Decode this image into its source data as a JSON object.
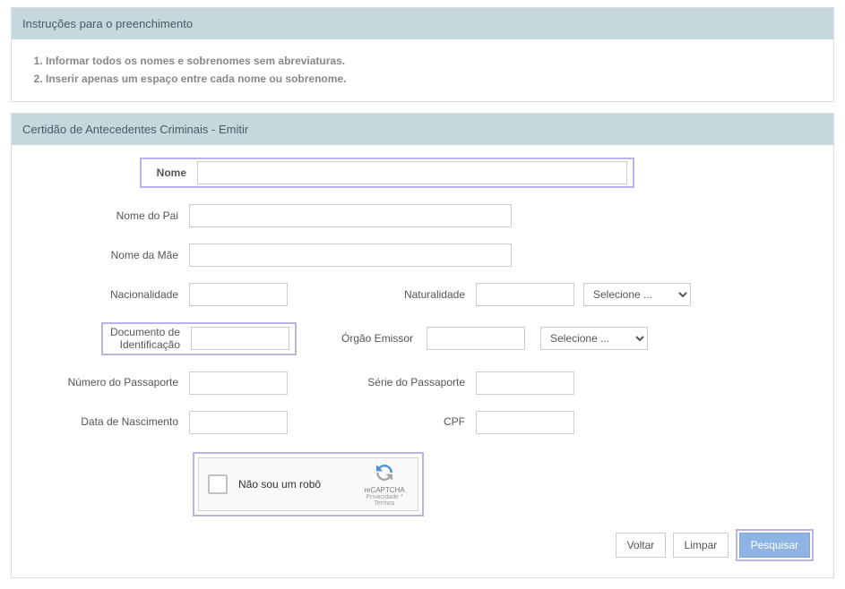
{
  "instructions": {
    "header": "Instruções para o preenchimento",
    "items": [
      "Informar todos os nomes e sobrenomes sem abreviaturas.",
      "Inserir apenas um espaço entre cada nome ou sobrenome."
    ]
  },
  "form": {
    "header": "Certidão de Antecedentes Criminais - Emitir",
    "labels": {
      "nome": "Nome",
      "nome_pai": "Nome do Pai",
      "nome_mae": "Nome da Mãe",
      "nacionalidade": "Nacionalidade",
      "naturalidade": "Naturalidade",
      "documento": "Documento de Identificação",
      "orgao": "Órgão Emissor",
      "passaporte_num": "Número do Passaporte",
      "passaporte_serie": "Série do Passaporte",
      "data_nasc": "Data de Nascimento",
      "cpf": "CPF"
    },
    "values": {
      "nome": "",
      "nome_pai": "",
      "nome_mae": "",
      "nacionalidade": "",
      "naturalidade": "",
      "documento": "",
      "orgao": "",
      "passaporte_num": "",
      "passaporte_serie": "",
      "data_nasc": "",
      "cpf": ""
    },
    "select_placeholder": "Selecione ...",
    "select_naturalidade": "Selecione ...",
    "select_orgao": "Selecione ..."
  },
  "recaptcha": {
    "label": "Não sou um robô",
    "brand": "reCAPTCHA",
    "terms": "Privacidade * Termos"
  },
  "buttons": {
    "voltar": "Voltar",
    "limpar": "Limpar",
    "pesquisar": "Pesquisar"
  }
}
